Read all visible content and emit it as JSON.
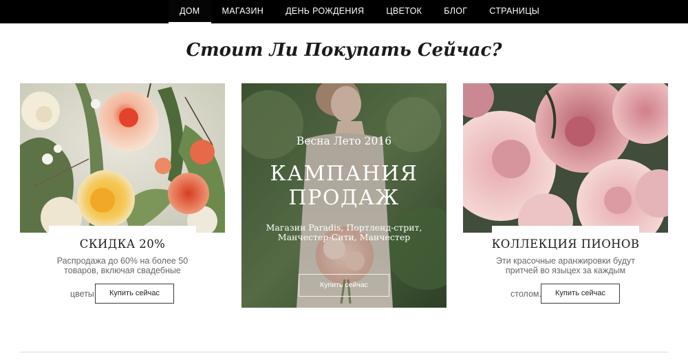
{
  "nav": {
    "items": [
      {
        "label": "ДОМ"
      },
      {
        "label": "МАГАЗИН"
      },
      {
        "label": "ДЕНЬ РОЖДЕНИЯ"
      },
      {
        "label": "ЦВЕТОК"
      },
      {
        "label": "БЛОГ"
      },
      {
        "label": "СТРАНИЦЫ"
      }
    ],
    "active_index": 0
  },
  "section": {
    "title": "Стоит Ли Покупать Сейчас?"
  },
  "cards": {
    "left": {
      "heading": "СКИДКА 20%",
      "description": "Распродажа до 60% на более 50 товаров, включая свадебные",
      "tail": "цветы",
      "button_label": "Купить сейчас"
    },
    "center": {
      "subtitle": "Весна Лето 2016",
      "title": "КАМПАНИЯ ПРОДАЖ",
      "address": "Магазин Paradis, Портленд-стрит, Манчестер-Сити, Манчестер",
      "button_label": "Купить сейчас"
    },
    "right": {
      "heading": "КОЛЛЕКЦИЯ ПИОНОВ",
      "description": "Эти красочные аранжировки будут притчей во языцех за каждым",
      "tail": "столом.",
      "button_label": "Купить сейчас"
    }
  },
  "colors": {
    "nav_background": "#000000",
    "nav_text": "#ffffff",
    "text_dark": "#1a1a1a",
    "text_muted": "#666666",
    "button_border": "#3a3a3a",
    "divider": "#dcdcdc"
  },
  "images": {
    "left": "mixed-flower-bouquet-photo",
    "center": "bride-with-bouquet-photo",
    "right": "pink-peonies-photo"
  }
}
